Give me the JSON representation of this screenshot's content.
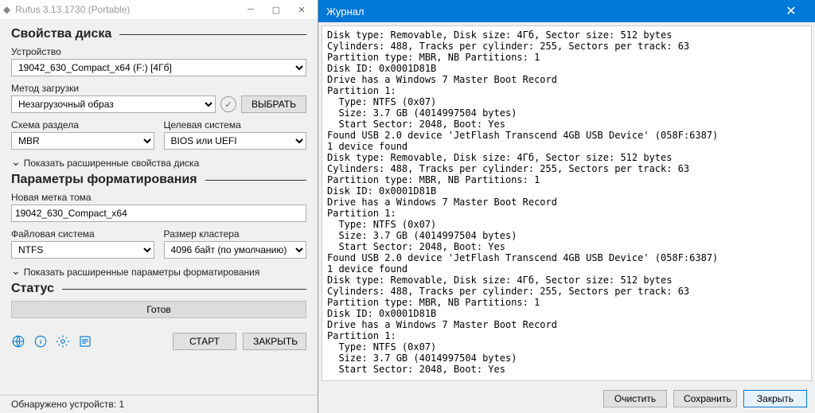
{
  "main": {
    "title": "Rufus 3.13.1730 (Portable)",
    "sections": {
      "drive_props": "Свойства диска",
      "format_opts": "Параметры форматирования",
      "status": "Статус"
    },
    "device": {
      "label": "Устройство",
      "value": "19042_630_Compact_x64 (F:) [4Гб]"
    },
    "boot": {
      "label": "Метод загрузки",
      "value": "Незагрузочный образ",
      "select_btn": "ВЫБРАТЬ"
    },
    "partition": {
      "label": "Схема раздела",
      "value": "MBR"
    },
    "target": {
      "label": "Целевая система",
      "value": "BIOS или UEFI"
    },
    "advanced_drive": "Показать расширенные свойства диска",
    "volume_label": {
      "label": "Новая метка тома",
      "value": "19042_630_Compact_x64"
    },
    "filesystem": {
      "label": "Файловая система",
      "value": "NTFS"
    },
    "cluster": {
      "label": "Размер кластера",
      "value": "4096 байт (по умолчанию)"
    },
    "advanced_format": "Показать расширенные параметры форматирования",
    "status_text": "Готов",
    "start_btn": "СТАРТ",
    "close_btn": "ЗАКРЫТЬ",
    "statusline": "Обнаружено устройств: 1"
  },
  "log": {
    "title": "Журнал",
    "clear_btn": "Очистить",
    "save_btn": "Сохранить",
    "close_btn": "Закрыть",
    "lines": "Disk type: Removable, Disk size: 4Гб, Sector size: 512 bytes\nCylinders: 488, Tracks per cylinder: 255, Sectors per track: 63\nPartition type: MBR, NB Partitions: 1\nDisk ID: 0x0001D81B\nDrive has a Windows 7 Master Boot Record\nPartition 1:\n  Type: NTFS (0x07)\n  Size: 3.7 GB (4014997504 bytes)\n  Start Sector: 2048, Boot: Yes\nFound USB 2.0 device 'JetFlash Transcend 4GB USB Device' (058F:6387)\n1 device found\nDisk type: Removable, Disk size: 4Гб, Sector size: 512 bytes\nCylinders: 488, Tracks per cylinder: 255, Sectors per track: 63\nPartition type: MBR, NB Partitions: 1\nDisk ID: 0x0001D81B\nDrive has a Windows 7 Master Boot Record\nPartition 1:\n  Type: NTFS (0x07)\n  Size: 3.7 GB (4014997504 bytes)\n  Start Sector: 2048, Boot: Yes\nFound USB 2.0 device 'JetFlash Transcend 4GB USB Device' (058F:6387)\n1 device found\nDisk type: Removable, Disk size: 4Гб, Sector size: 512 bytes\nCylinders: 488, Tracks per cylinder: 255, Sectors per track: 63\nPartition type: MBR, NB Partitions: 1\nDisk ID: 0x0001D81B\nDrive has a Windows 7 Master Boot Record\nPartition 1:\n  Type: NTFS (0x07)\n  Size: 3.7 GB (4014997504 bytes)\n  Start Sector: 2048, Boot: Yes"
  }
}
